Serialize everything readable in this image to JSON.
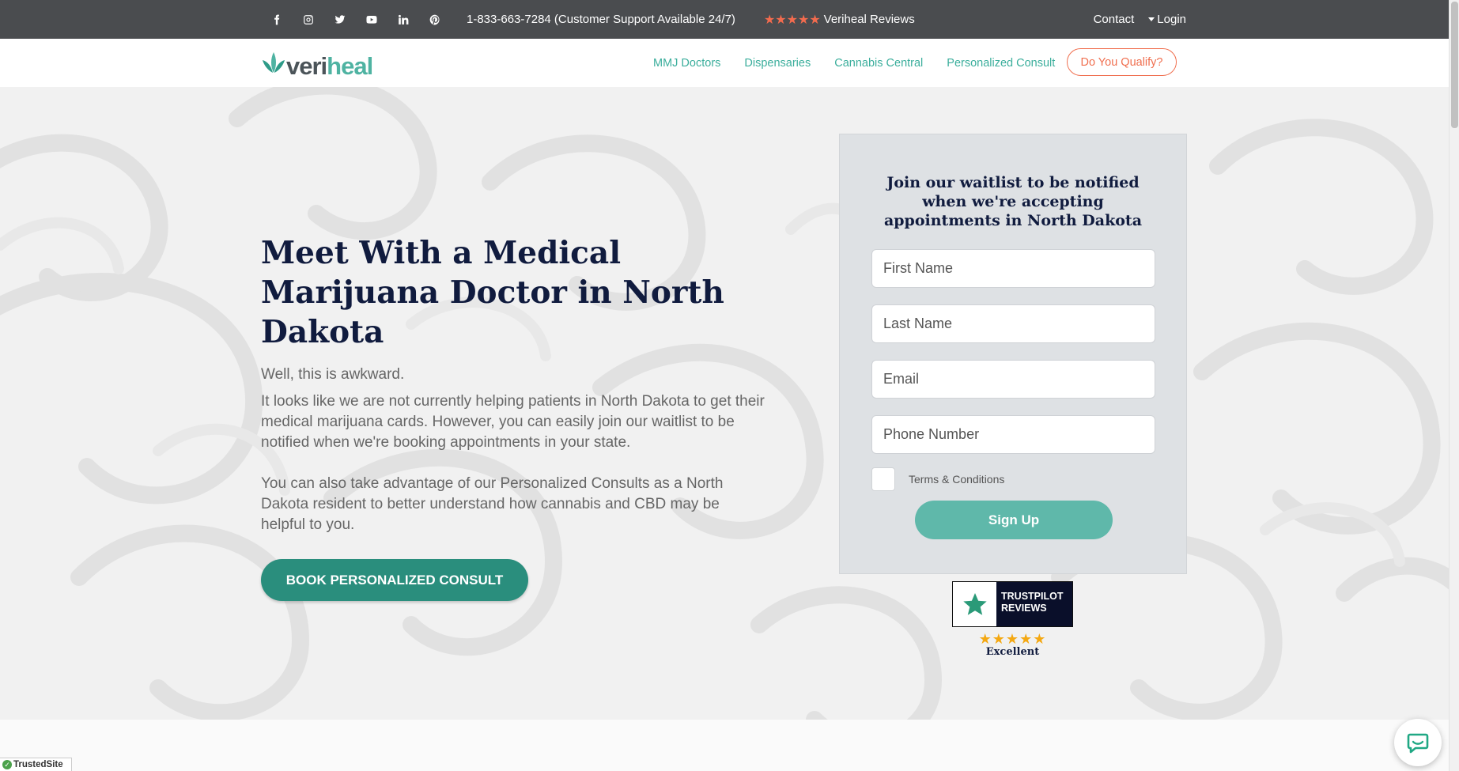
{
  "topbar": {
    "social": [
      "facebook-icon",
      "instagram-icon",
      "twitter-icon",
      "youtube-icon",
      "linkedin-icon",
      "pinterest-icon"
    ],
    "phone": "1-833-663-7284 (Customer Support Available 24/7)",
    "reviews_stars": "★★★★★",
    "reviews_label": "Veriheal Reviews",
    "contact": "Contact",
    "login": "Login"
  },
  "header": {
    "logo_part1": "veri",
    "logo_part2": "heal",
    "nav": [
      "MMJ Doctors",
      "Dispensaries",
      "Cannabis Central",
      "Personalized Consult"
    ],
    "qualify": "Do You Qualify?"
  },
  "hero": {
    "title": "Meet With a Medical Marijuana Doctor in North Dakota",
    "lead": "Well, this is awkward.",
    "para1": "It looks like we are not currently helping patients in North Dakota to get their medical marijuana cards. However, you can easily join our waitlist to be notified when we're booking appointments in your state.",
    "para2": "You can also take advantage of our Personalized Consults as a North Dakota resident to better understand how cannabis and CBD may be helpful to you.",
    "cta": "BOOK PERSONALIZED CONSULT"
  },
  "form": {
    "title": "Join our waitlist to be notified when we're accepting appointments in North Dakota",
    "first_name": "First Name",
    "last_name": "Last Name",
    "email": "Email",
    "phone": "Phone Number",
    "terms": "Terms & Conditions",
    "submit": "Sign Up"
  },
  "trustpilot": {
    "line1": "TRUSTPILOT",
    "line2": "REVIEWS",
    "stars": "★★★★★",
    "rating": "Excellent"
  },
  "trustedsite": "TrustedSite",
  "colors": {
    "topbar": "#4a4c4f",
    "brand_green": "#3bae9c",
    "accent_orange": "#f06f4f",
    "cta_green": "#2a8e7d",
    "navy": "#101b3e"
  }
}
